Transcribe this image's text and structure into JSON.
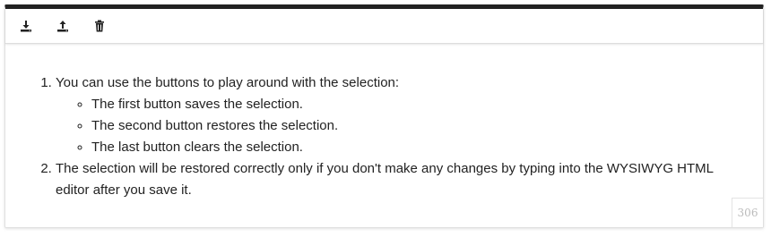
{
  "toolbar": {
    "buttons": [
      {
        "icon": "download-icon"
      },
      {
        "icon": "upload-icon"
      },
      {
        "icon": "trash-icon"
      }
    ]
  },
  "content": {
    "list": [
      {
        "text": "You can use the buttons to play around with the selection:",
        "sub": [
          "The first button saves the selection.",
          "The second button restores the selection.",
          "The last button clears the selection."
        ]
      },
      {
        "text": "The selection will be restored correctly only if you don't make any changes by typing into the WYSIWYG HTML editor after you save it."
      }
    ]
  },
  "char_counter": "306",
  "colors": {
    "top_border": "#222222",
    "text": "#222222",
    "counter_text": "#bbbbbb"
  }
}
